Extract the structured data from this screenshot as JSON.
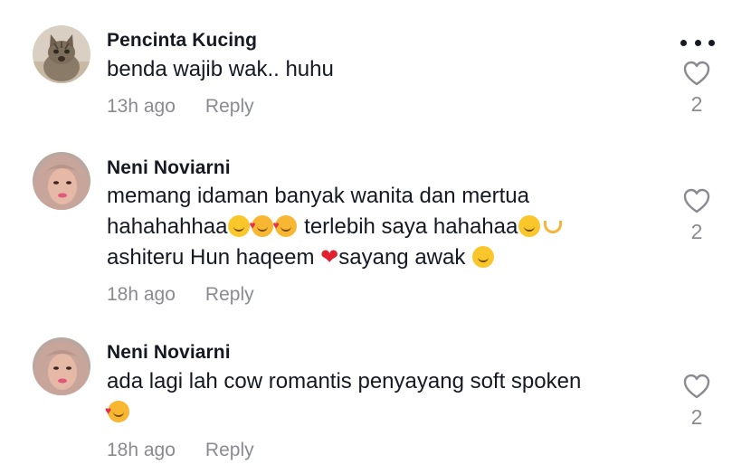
{
  "more_icon": "more-horizontal-icon",
  "comments": [
    {
      "username": "Pencinta Kucing",
      "text": "benda wajib wak.. huhu",
      "time": "13h ago",
      "reply_label": "Reply",
      "likes": "2",
      "avatar": "cat-photo"
    },
    {
      "username": "Neni Noviarni",
      "lines": [
        {
          "a": "memang idaman banyak wanita dan mertua"
        },
        {
          "a": "hahahahhaa",
          "b": " terlebih saya hahahaa"
        },
        {
          "a": "ashiteru Hun haqeem ",
          "b": "sayang awak "
        }
      ],
      "time": "18h ago",
      "reply_label": "Reply",
      "likes": "2",
      "avatar": "woman-hijab-photo"
    },
    {
      "username": "Neni Noviarni",
      "text": "ada lagi lah cow romantis penyayang soft spoken",
      "time": "18h ago",
      "reply_label": "Reply",
      "likes": "2",
      "avatar": "woman-hijab-photo"
    }
  ],
  "colors": {
    "text": "#161823",
    "muted": "#8a8b91",
    "heart_emoji": "#e0202e"
  }
}
